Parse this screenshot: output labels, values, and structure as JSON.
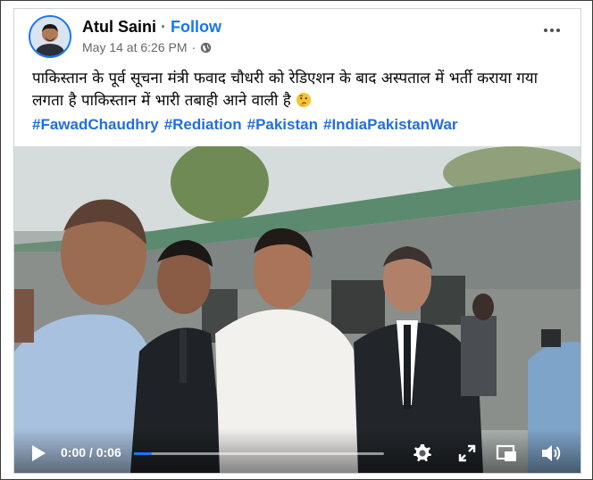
{
  "post": {
    "author": "Atul Saini",
    "separator": "·",
    "follow_label": "Follow",
    "timestamp": "May 14 at 6:26 PM",
    "meta_separator": "·",
    "audience_icon": "globe-icon",
    "more_icon": "more-options-icon",
    "text": "पाकिस्तान के पूर्व सूचना मंत्री फवाद चौधरी को रेडिएशन के बाद अस्पताल में भर्ती कराया गया लगता है पाकिस्तान में भारी तबाही आने वाली है",
    "emoji": "thinking-face-emoji",
    "hashtags": [
      "#FawadChaudhry",
      "#Rediation",
      "#Pakistan",
      "#IndiaPakistanWar"
    ]
  },
  "video": {
    "current_time": "0:00",
    "time_separator": "/",
    "duration": "0:06",
    "progress_fraction": 0.0,
    "controls": [
      "play-icon",
      "settings-gear-icon",
      "fullscreen-expand-icon",
      "picture-in-picture-icon",
      "volume-icon"
    ]
  },
  "colors": {
    "accent": "#1877f2",
    "hashtag": "#216fdb",
    "muted_text": "#65676b"
  }
}
